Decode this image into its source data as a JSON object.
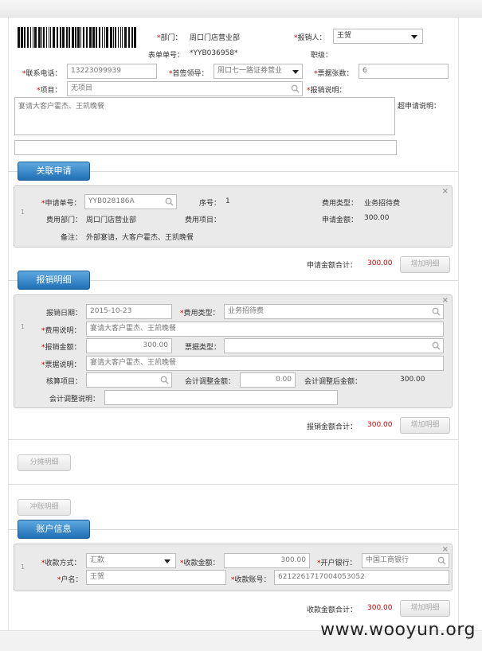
{
  "header": {
    "dept_label": "*部门：",
    "dept_value": "周口门店营业部",
    "reporter_label": "*报销人：",
    "reporter_value": "王贺",
    "form_no_label": "表单单号：",
    "form_no_value": "*YYB036958*",
    "position_label": "职级：",
    "phone_label": "*联系电话：",
    "phone_value": "13223099939",
    "leader_label": "*首签领导：",
    "leader_value": "周口七一路证券营业",
    "tickets_label": "*票据张数：",
    "tickets_value": "6",
    "project_label": "*项目：",
    "project_value": "无项目",
    "reason_label": "*报销说明：",
    "reason_value": "宴请大客户霍杰、王凯晚餐",
    "over_label": "超申请说明："
  },
  "sections": {
    "related": "关联申请",
    "detail": "报销明细",
    "account": "账户信息"
  },
  "related_card": {
    "rownum": "1",
    "apply_no_label": "*申请单号：",
    "apply_no_value": "YYB028186A",
    "seq_label": "序号：",
    "seq_value": "1",
    "fee_type_label": "费用类型：",
    "fee_type_value": "业务招待费",
    "fee_dept_label": "费用部门：",
    "fee_dept_value": "周口门店营业部",
    "fee_item_label": "费用项目：",
    "apply_amount_label": "申请金额：",
    "apply_amount_value": "300.00",
    "remark_label": "备注：",
    "remark_value": "外部宴请，大客户霍杰、王凯晚餐",
    "close": "×"
  },
  "related_total": {
    "label": "申请金额合计：",
    "value": "300.00",
    "button": "增加明细"
  },
  "detail_card": {
    "rownum": "1",
    "date_label": "报销日期：",
    "date_value": "2015-10-23",
    "fee_type_label": "*费用类型：",
    "fee_type_value": "业务招待费",
    "fee_desc_label": "*费用说明：",
    "fee_desc_value": "宴请大客户霍杰、王凯晚餐",
    "amount_label": "*报销金额：",
    "amount_value": "300.00",
    "ticket_type_label": "票据类型：",
    "ticket_desc_label": "*票据说明：",
    "ticket_desc_value": "宴请大客户霍杰、王凯晚餐",
    "check_item_label": "核算项目：",
    "adjust_label": "会计调整金额：",
    "adjust_value": "0.00",
    "after_adjust_label": "会计调整后金额：",
    "after_adjust_value": "300.00",
    "adjust_desc_label": "会计调整说明：",
    "close": "×"
  },
  "detail_total": {
    "label": "报销金额合计：",
    "value": "300.00",
    "button": "增加明细"
  },
  "split_button": "分摊明细",
  "offset_button": "冲账明细",
  "account_card": {
    "rownum": "1",
    "method_label": "*收款方式：",
    "method_value": "汇款",
    "amount_label": "*收款金额：",
    "amount_value": "300.00",
    "bank_label": "*开户银行：",
    "bank_value": "中国工商银行",
    "name_label": "*户名：",
    "name_value": "王贺",
    "account_label": "*收款账号：",
    "account_value": "6212261717004053052",
    "close": "×"
  },
  "account_total": {
    "label": "收款金额合计：",
    "value": "300.00",
    "button": "增加明细"
  },
  "watermark": "www.wooyun.org"
}
